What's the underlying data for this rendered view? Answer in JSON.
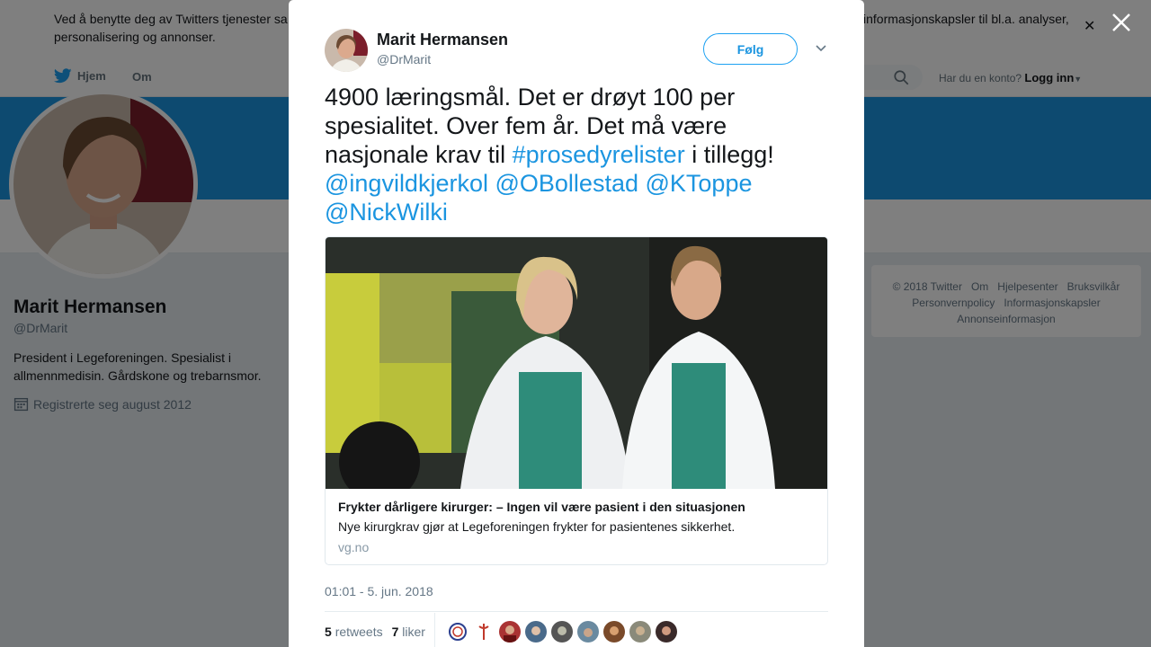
{
  "cookie": {
    "text_left": "Ved å benytte deg av Twitters tjenester sa personalisering og annonser.",
    "text_right": "informasjonskapsler til bl.a. analyser,",
    "close_icon": "close-icon"
  },
  "nav": {
    "home_label": "Hjem",
    "about_label": "Om",
    "account_question": "Har du en konto?",
    "login_label": "Logg inn"
  },
  "profile": {
    "name": "Marit Hermansen",
    "handle": "@DrMarit",
    "bio": "President i Legeforeningen. Spesialist i allmennmedisin. Gårdskone og trebarnsmor.",
    "joined": "Registrerte seg august 2012"
  },
  "footer": {
    "links": [
      "© 2018 Twitter",
      "Om",
      "Hjelpesenter",
      "Bruksvilkår",
      "Personvernpolicy",
      "Informasjonskapsler",
      "Annonseinformasjon"
    ]
  },
  "tweet": {
    "author_name": "Marit Hermansen",
    "author_handle": "@DrMarit",
    "follow_label": "Følg",
    "text_1": "4900 læringsmål. Det er drøyt 100 per spesialitet. Over fem år. Det må være nasjonale krav til ",
    "hashtag": "#prosedyrelister",
    "text_2": " i tillegg! ",
    "mentions": [
      "@ingvildkjerkol",
      "@OBollestad",
      "@KToppe",
      "@NickWilki"
    ],
    "card": {
      "title": "Frykter dårligere kirurger: – Ingen vil være pasient i den situasjonen",
      "description": "Nye kirurgkrav gjør at Legeforeningen frykter for pasientenes sikkerhet.",
      "domain": "vg.no"
    },
    "timestamp": "01:01 - 5. jun. 2018",
    "retweets_count": "5",
    "retweets_label": "retweets",
    "likes_count": "7",
    "likes_label": "liker"
  },
  "colors": {
    "accent": "#1da1f2",
    "link": "#1b95e0",
    "banner": "#1b95e0"
  }
}
